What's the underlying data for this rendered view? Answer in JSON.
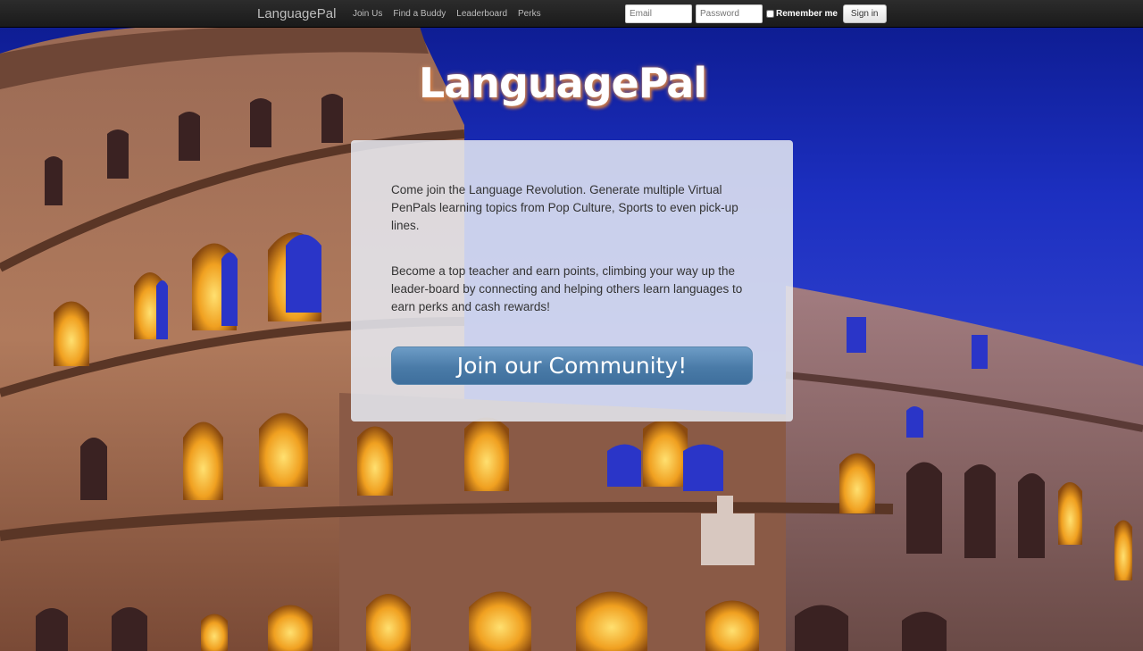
{
  "nav": {
    "brand": "LanguagePal",
    "links": [
      "Join Us",
      "Find a Buddy",
      "Leaderboard",
      "Perks"
    ],
    "email_placeholder": "Email",
    "password_placeholder": "Password",
    "remember_label": "Remember me",
    "signin_label": "Sign in"
  },
  "hero": {
    "logo_text": "LanguagePal"
  },
  "panel": {
    "paragraph1": "Come join the Language Revolution. Generate multiple Virtual PenPals learning topics from Pop Culture, Sports to even pick-up lines.",
    "paragraph2": "Become a top teacher and earn points, climbing your way up the leader-board by connecting and helping others learn languages to earn perks and cash rewards!",
    "cta_label": "Join our Community!"
  },
  "colors": {
    "navbar": "#1f1f1f",
    "sky": "#1c2fc0",
    "cta": "#4a7ba8"
  }
}
